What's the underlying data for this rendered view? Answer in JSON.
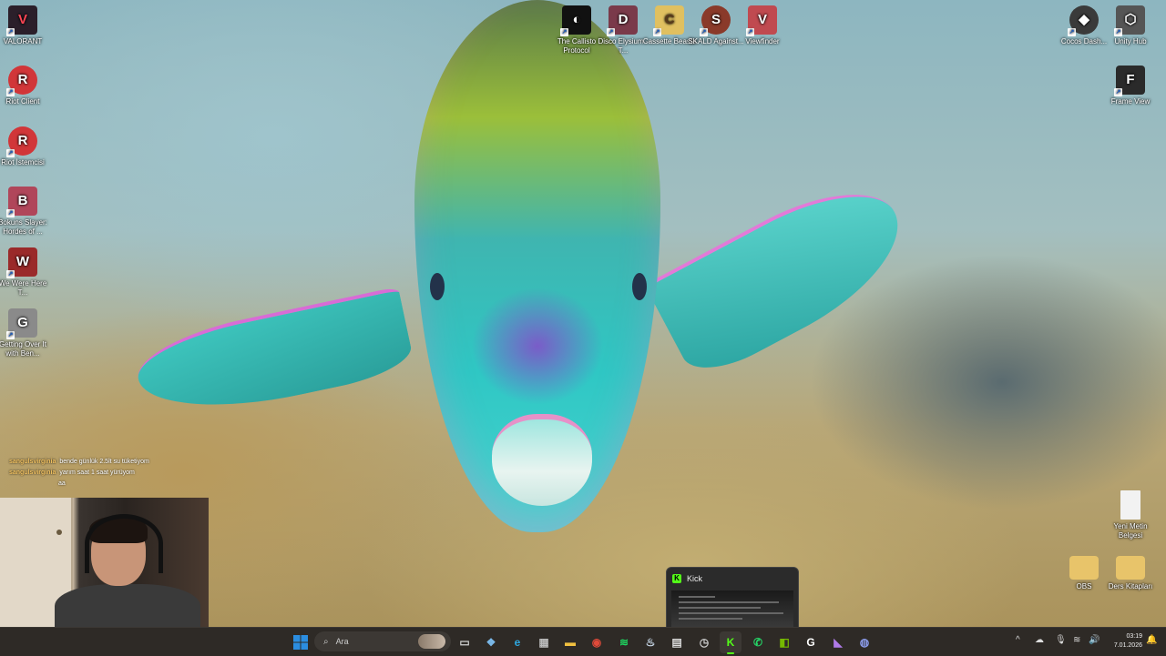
{
  "desktop": {
    "icons_left": [
      {
        "label": "VALORANT",
        "icon": "valorant-icon",
        "color": "#2b1f2a",
        "glyph": "V"
      },
      {
        "label": "Riot Client",
        "icon": "riot-client-icon",
        "color": "#d13639",
        "glyph": "R"
      },
      {
        "label": "Riot İstemcisi",
        "icon": "riot-client-icon",
        "color": "#d13639",
        "glyph": "R"
      },
      {
        "label": "Bokuns Slayer: Hordes of ...",
        "icon": "game-icon",
        "color": "#b0465a",
        "glyph": "B"
      },
      {
        "label": "We Were Here T...",
        "icon": "walkie-talkie-icon",
        "color": "#9a2a2a",
        "glyph": "W"
      },
      {
        "label": "Getting Over It with Ben...",
        "icon": "hammer-icon",
        "color": "#8a8a8a",
        "glyph": "G"
      }
    ],
    "icons_top": [
      {
        "label": "The Callisto Protocol",
        "icon": "callisto-protocol-icon",
        "color": "#111111",
        "glyph": "◐"
      },
      {
        "label": "Disco Elysium - T...",
        "icon": "disco-elysium-icon",
        "color": "#7a3a4a",
        "glyph": "D"
      },
      {
        "label": "Cassette Beasts",
        "icon": "cassette-beasts-icon",
        "color": "#e0c060",
        "glyph": "C"
      },
      {
        "label": "SKALD Against...",
        "icon": "skald-icon",
        "color": "#8a3a2a",
        "glyph": "S"
      },
      {
        "label": "Viewfinder",
        "icon": "viewfinder-icon",
        "color": "#c04a50",
        "glyph": "V"
      }
    ],
    "icons_right": [
      {
        "label": "Cocos Dash...",
        "icon": "cocos-dashboard-icon",
        "color": "#3a3a3a",
        "glyph": "◆"
      },
      {
        "label": "Unity Hub",
        "icon": "unity-hub-icon",
        "color": "#555555",
        "glyph": "⬡"
      },
      {
        "label": "Frame View",
        "icon": "frame-view-icon",
        "color": "#2a2a2a",
        "glyph": "F"
      },
      {
        "label": "Yeni Metin Belgesi",
        "icon": "text-document-icon",
        "color": "#f2f2f2",
        "glyph": ""
      },
      {
        "label": "OBS",
        "icon": "folder-icon",
        "color": "#e8c46a",
        "glyph": ""
      },
      {
        "label": "Ders Kitapları",
        "icon": "folder-icon",
        "color": "#e8c46a",
        "glyph": ""
      }
    ]
  },
  "chat": {
    "messages": [
      {
        "user": "sangulsvirginia",
        "text": "bende günlük 2.5lt su tüketiyom"
      },
      {
        "user": "sangulsvirginia",
        "text": "yarım saat 1 saat yürüyom"
      },
      {
        "user": "",
        "text": "aa"
      }
    ]
  },
  "preview": {
    "title": "Kick",
    "badge": "K"
  },
  "taskbar": {
    "search_placeholder": "Ara",
    "apps": [
      {
        "name": "task-view-icon",
        "glyph": "▭",
        "color": "#cfcfcf"
      },
      {
        "name": "widgets-icon",
        "glyph": "❖",
        "color": "#7ab8e8"
      },
      {
        "name": "edge-icon",
        "glyph": "e",
        "color": "#2fa8e0"
      },
      {
        "name": "store-icon",
        "glyph": "▦",
        "color": "#bbbbbb"
      },
      {
        "name": "file-explorer-icon",
        "glyph": "▬",
        "color": "#f0c040"
      },
      {
        "name": "chrome-icon",
        "glyph": "◉",
        "color": "#e04a3a"
      },
      {
        "name": "spotify-icon",
        "glyph": "≋",
        "color": "#1ed760"
      },
      {
        "name": "steam-icon",
        "glyph": "♨",
        "color": "#c8d8e8"
      },
      {
        "name": "terminal-icon",
        "glyph": "▤",
        "color": "#dddddd"
      },
      {
        "name": "clock-app-icon",
        "glyph": "◷",
        "color": "#cccccc"
      },
      {
        "name": "kick-icon",
        "glyph": "K",
        "color": "#53fc18"
      },
      {
        "name": "whatsapp-icon",
        "glyph": "✆",
        "color": "#25d366"
      },
      {
        "name": "nvidia-icon",
        "glyph": "◧",
        "color": "#76b900"
      },
      {
        "name": "g-app-icon",
        "glyph": "G",
        "color": "#ffffff"
      },
      {
        "name": "visual-studio-icon",
        "glyph": "◣",
        "color": "#b07ae8"
      },
      {
        "name": "circle-app-icon",
        "glyph": "◍",
        "color": "#8a9ae8"
      }
    ],
    "tray": {
      "time": "03:19",
      "date": "7.01.2026"
    }
  },
  "colors": {
    "taskbar_bg": "#2e2a26",
    "kick_green": "#53fc18",
    "windows_blue": "#2b8de0"
  }
}
